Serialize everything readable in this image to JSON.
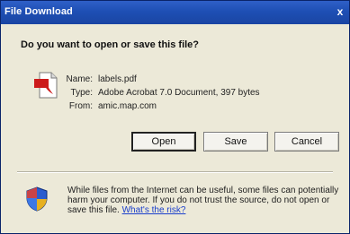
{
  "window": {
    "title": "File Download",
    "close_glyph": "x"
  },
  "dialog": {
    "question": "Do you want to open or save this file?",
    "file": {
      "icon": "pdf-document-icon",
      "name_label": "Name:",
      "name_value": "labels.pdf",
      "type_label": "Type:",
      "type_value": "Adobe Acrobat 7.0 Document, 397 bytes",
      "from_label": "From:",
      "from_value": "amic.map.com"
    },
    "buttons": {
      "open": "Open",
      "save": "Save",
      "cancel": "Cancel"
    },
    "warning": {
      "icon": "shield-icon",
      "text": "While files from the Internet can be useful, some files can potentially harm your computer. If you do not trust the source, do not open or save this file.",
      "link": "What's the risk?"
    }
  },
  "colors": {
    "titlebar": "#1e4fb4",
    "dialog_bg": "#ece9d8",
    "link": "#1a3fcc",
    "pdf_red": "#cc1a1a"
  }
}
